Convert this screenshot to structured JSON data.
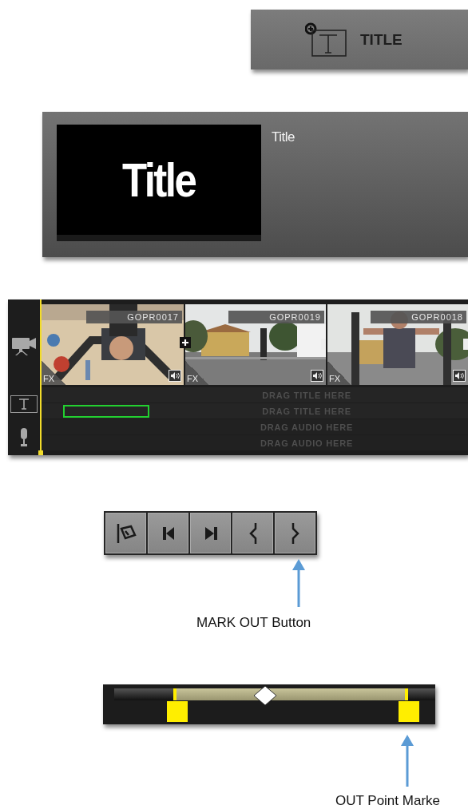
{
  "title_button": {
    "label": "TITLE"
  },
  "title_card": {
    "thumbnail_text": "Title",
    "name": "Title"
  },
  "timeline": {
    "clips": [
      {
        "name": "GOPR0017",
        "fx": "FX",
        "selected": true,
        "add_button": true,
        "kind": "picture"
      },
      {
        "name": "GOPR0019",
        "fx": "FX",
        "selected": false,
        "add_button": false,
        "kind": "picture"
      },
      {
        "name": "GOPR0018",
        "fx": "FX",
        "selected": false,
        "add_button": false,
        "kind": "picture"
      }
    ],
    "tracks": [
      {
        "kind": "title",
        "label": "DRAG TITLE HERE",
        "drop_target": false
      },
      {
        "kind": "title",
        "label": "DRAG TITLE HERE",
        "drop_target": true
      },
      {
        "kind": "audio",
        "label": "DRAG AUDIO HERE",
        "drop_target": false
      },
      {
        "kind": "audio",
        "label": "DRAG AUDIO HERE",
        "drop_target": false
      }
    ]
  },
  "transport_buttons": [
    {
      "kind": "tag"
    },
    {
      "kind": "previous"
    },
    {
      "kind": "next"
    },
    {
      "kind": "mark_in"
    },
    {
      "kind": "mark_out"
    }
  ],
  "mark_out_callout": {
    "label": "MARK OUT Button"
  },
  "scrubber": {
    "playhead": {
      "level": 0.47
    },
    "markers": [
      {
        "kind": "in",
        "level": 0.19
      },
      {
        "kind": "out",
        "level": 0.91
      }
    ]
  },
  "out_point_callout": {
    "label": "OUT Point Marke"
  }
}
